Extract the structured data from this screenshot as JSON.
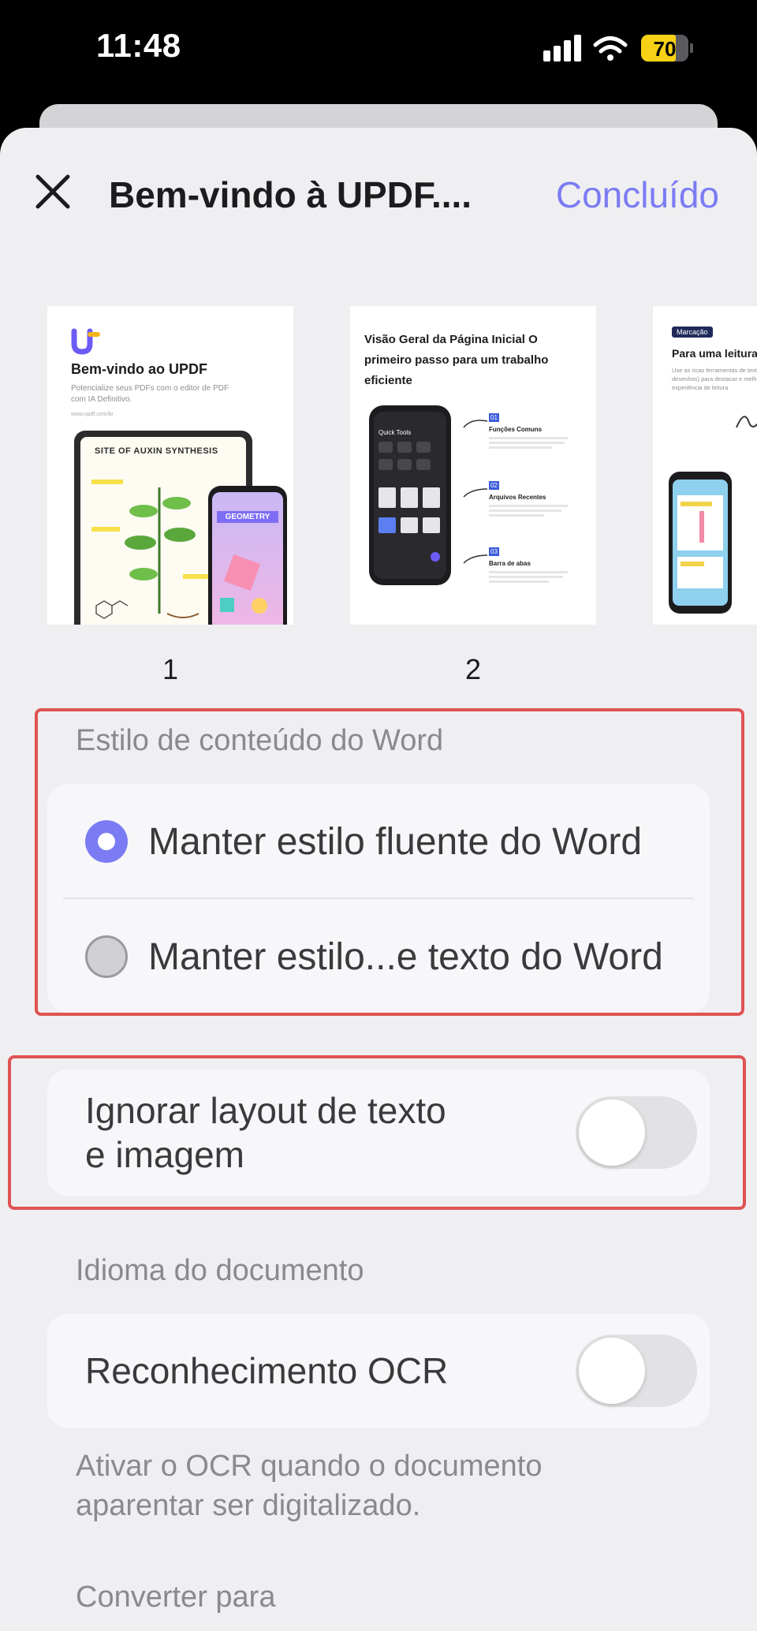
{
  "status_bar": {
    "time": "11:48",
    "battery_level": "70",
    "icons": [
      "signal-icon",
      "wifi-icon",
      "battery-icon"
    ]
  },
  "nav": {
    "title": "Bem-vindo à UPDF....",
    "done_label": "Concluído",
    "close_icon": "close-icon"
  },
  "pages": [
    {
      "number": "1",
      "heading": "Bem-vindo ao UPDF",
      "subtext": "Potencialize seus PDFs com o editor de PDF com IA Definitivo.",
      "link": "www.updf.com/br",
      "tablet_title": "SITE OF AUXIN SYNTHESIS",
      "phone_title": "GEOMETRY"
    },
    {
      "number": "2",
      "heading": "Visão Geral da Página Inicial O primeiro passo para um trabalho eficiente",
      "phone_label": "Quick Tools",
      "steps": [
        {
          "num": "01",
          "title": "Funções Comuns"
        },
        {
          "num": "02",
          "title": "Arquivos Recentes"
        },
        {
          "num": "03",
          "title": "Barra de abas"
        }
      ]
    },
    {
      "badge": "Marcação",
      "heading": "Para uma leitura",
      "subtext": "Use as ricas ferramentas de texto, desenhos) para destacar e melhorar sua experiência de leitura"
    }
  ],
  "word_style": {
    "label": "Estilo de conteúdo do Word",
    "options": [
      {
        "label": "Manter estilo fluente do Word",
        "selected": true
      },
      {
        "label": "Manter estilo...e texto do Word",
        "selected": false
      }
    ]
  },
  "ignore_layout": {
    "label_line1": "Ignorar layout de texto",
    "label_line2": "e imagem",
    "enabled": false
  },
  "document_language": {
    "label": "Idioma do documento",
    "ocr_label": "Reconhecimento OCR",
    "ocr_enabled": false,
    "helper_line1": "Ativar o OCR quando o documento",
    "helper_line2": "aparentar ser digitalizado."
  },
  "convert_to": {
    "label": "Converter para"
  },
  "colors": {
    "accent": "#7b7cf3",
    "highlight": "#e05353",
    "battery": "#f7d116"
  }
}
